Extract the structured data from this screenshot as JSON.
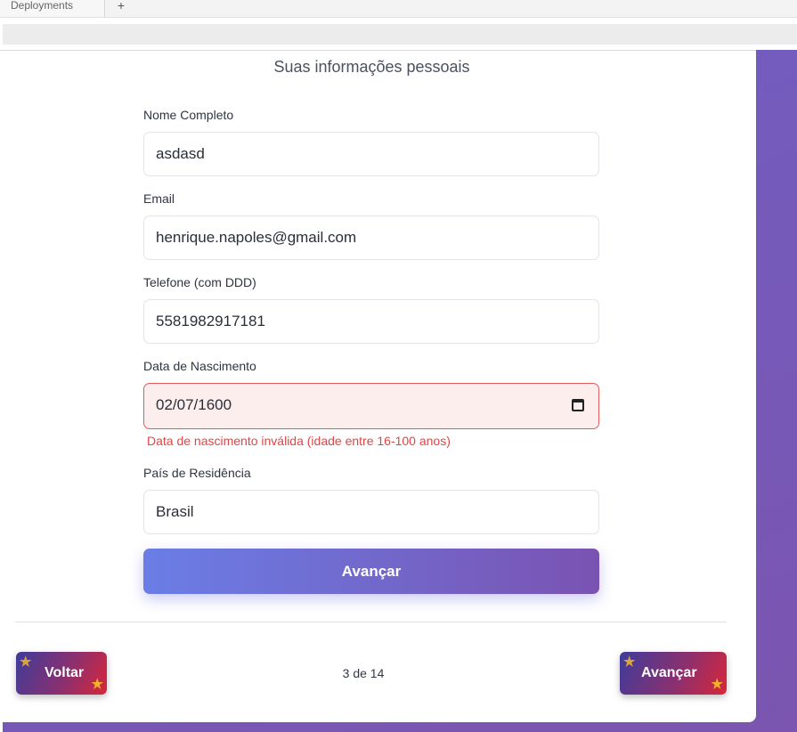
{
  "browser": {
    "tab_label": "Deployments",
    "new_tab_symbol": "+"
  },
  "form": {
    "section_title": "Suas informações pessoais",
    "full_name": {
      "label": "Nome Completo",
      "value": "asdasd"
    },
    "email": {
      "label": "Email",
      "value": "henrique.napoles@gmail.com"
    },
    "phone": {
      "label": "Telefone (com DDD)",
      "value": "5581982917181"
    },
    "birth_date": {
      "label": "Data de Nascimento",
      "value": "02/07/1600",
      "error": "Data de nascimento inválida (idade entre 16-100 anos)"
    },
    "country": {
      "label": "País de Residência",
      "value": "Brasil"
    },
    "submit_label": "Avançar"
  },
  "navigation": {
    "prev_label": "Voltar",
    "next_label": "Avançar",
    "page_indicator": "3 de 14"
  },
  "icons": {
    "calendar": "calendar-icon",
    "star": "★"
  },
  "colors": {
    "background_purple": "#7358bb",
    "error_red": "#e04545",
    "submit_gradient_start": "#6a7ee6",
    "submit_gradient_end": "#7a53b2",
    "nav_gradient_start": "#3e3c9a",
    "nav_gradient_end": "#d8263a"
  }
}
